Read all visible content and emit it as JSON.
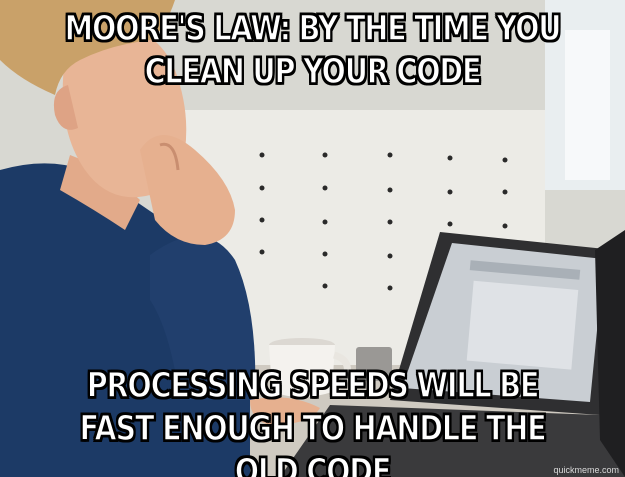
{
  "meme": {
    "top_text": "MOORE'S LAW: BY THE TIME YOU CLEAN UP YOUR CODE",
    "bottom_text": "PROCESSING SPEEDS WILL BE FAST ENOUGH TO HANDLE THE OLD CODE",
    "watermark": "quickmeme.com"
  },
  "scene": {
    "subject": "man-at-laptop-thinking",
    "colors": {
      "wall": "#d8d8d2",
      "pegboard": "#ecebe6",
      "sweater": "#1c3a66",
      "skin": "#e8b596",
      "hair": "#c9a169",
      "laptop": "#2f2f31",
      "screen": "#c9ced3",
      "mug": "#f4f2ee",
      "desk": "#cfcac1"
    }
  }
}
